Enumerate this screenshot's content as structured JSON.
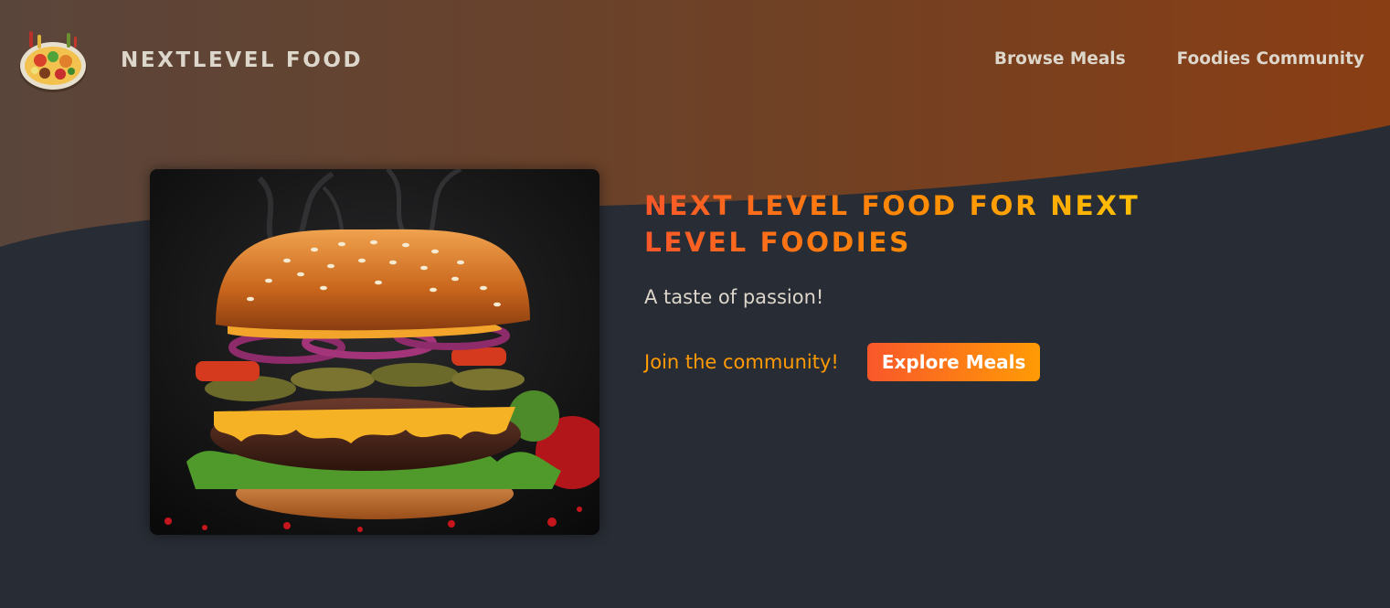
{
  "header": {
    "logo_text": "NEXTLEVEL FOOD",
    "logo_icon": "food-platter-icon",
    "nav": [
      {
        "label": "Browse Meals"
      },
      {
        "label": "Foodies Community"
      }
    ],
    "gradient_colors": [
      "#5a453b",
      "#8a3e14"
    ]
  },
  "hero": {
    "image_subject": "burger-photo",
    "title": "NEXT LEVEL FOOD FOR NEXT LEVEL FOODIES",
    "subtitle": "A taste of passion!",
    "cta_link": "Join the community!",
    "cta_button": "Explore Meals"
  },
  "colors": {
    "page_background": "#282c34",
    "text_light": "#ddd6cb",
    "accent_orange": "#f9572a",
    "accent_amber": "#ff9b05",
    "accent_yellow": "#ffc905"
  }
}
